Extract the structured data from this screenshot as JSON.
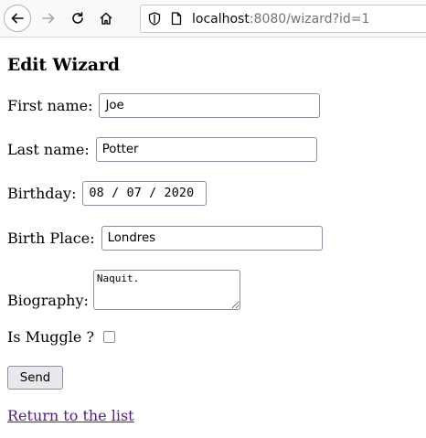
{
  "browser": {
    "url_host": "localhost",
    "url_rest": ":8080/wizard?id=1"
  },
  "page": {
    "title": "Edit Wizard",
    "first_name_label": "First name:",
    "first_name_value": "Joe",
    "last_name_label": "Last name:",
    "last_name_value": "Potter",
    "birthday_label": "Birthday:",
    "birthday_value": "08 / 07 / 2020",
    "birth_place_label": "Birth Place:",
    "birth_place_value": "Londres",
    "biography_label": "Biography:",
    "biography_value": "Naquit.",
    "muggle_label": "Is Muggle ?",
    "muggle_checked": false,
    "send_label": "Send",
    "return_link": "Return to the list"
  }
}
